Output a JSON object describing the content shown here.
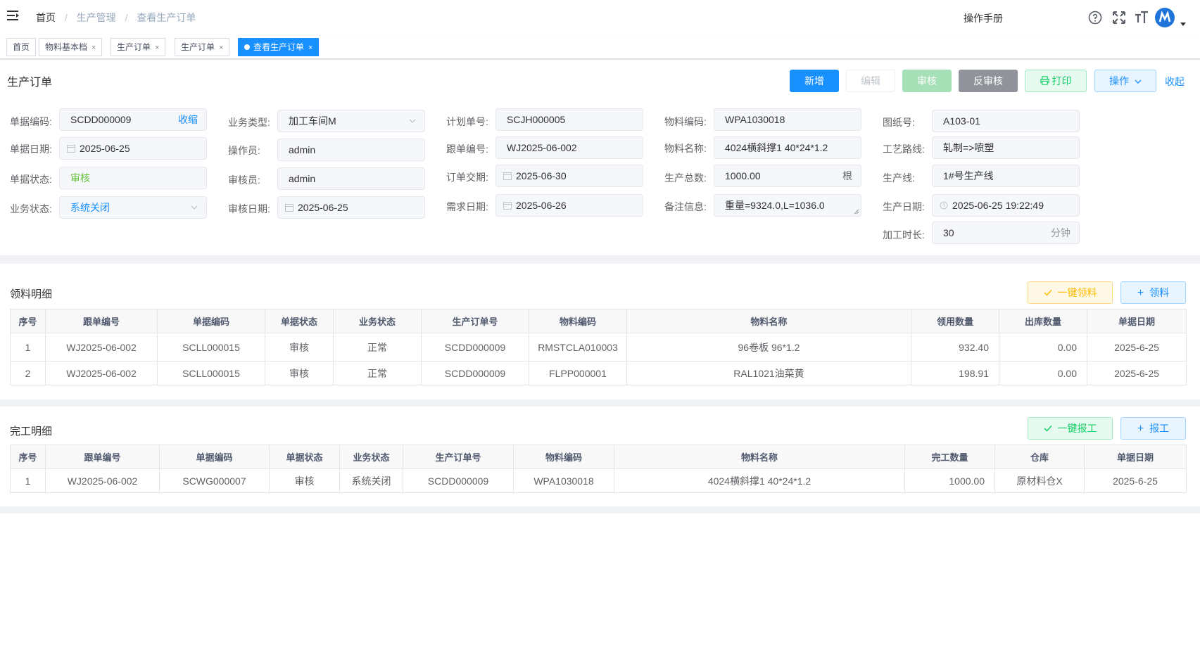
{
  "navbar": {
    "breadcrumb": [
      "首页",
      "生产管理",
      "查看生产订单"
    ],
    "manual_label": "操作手册"
  },
  "tags": [
    {
      "label": "首页",
      "active": false,
      "closable": false
    },
    {
      "label": "物料基本档",
      "active": false,
      "closable": true
    },
    {
      "label": "生产订单",
      "active": false,
      "closable": true
    },
    {
      "label": "生产订单",
      "active": false,
      "closable": true
    },
    {
      "label": "查看生产订单",
      "active": true,
      "closable": true
    }
  ],
  "header": {
    "title": "生产订单",
    "buttons": {
      "add": "新增",
      "edit": "编辑",
      "audit": "审核",
      "unaudit": "反审核",
      "print": "打印",
      "operate": "操作",
      "collapse": "收起"
    }
  },
  "form": {
    "col1": {
      "doc_code_label": "单据编码:",
      "doc_code": "SCDD000009",
      "doc_code_action": "收缩",
      "doc_date_label": "单据日期:",
      "doc_date": "2025-06-25",
      "doc_status_label": "单据状态:",
      "doc_status": "审核",
      "biz_status_label": "业务状态:",
      "biz_status": "系统关闭"
    },
    "col2": {
      "biz_type_label": "业务类型:",
      "biz_type": "加工车间M",
      "operator_label": "操作员:",
      "operator": "admin",
      "auditor_label": "审核员:",
      "auditor": "admin",
      "audit_date_label": "审核日期:",
      "audit_date": "2025-06-25"
    },
    "col3": {
      "plan_no_label": "计划单号:",
      "plan_no": "SCJH000005",
      "track_no_label": "跟单编号:",
      "track_no": "WJ2025-06-002",
      "delivery_label": "订单交期:",
      "delivery": "2025-06-30",
      "demand_date_label": "需求日期:",
      "demand_date": "2025-06-26"
    },
    "col4": {
      "mat_code_label": "物料编码:",
      "mat_code": "WPA1030018",
      "mat_name_label": "物料名称:",
      "mat_name": "4024横斜撑1 40*24*1.2",
      "total_label": "生产总数:",
      "total": "1000.00",
      "total_unit": "根",
      "remark_label": "备注信息:",
      "remark": "重量=9324.0,L=1036.0"
    },
    "col5": {
      "drawing_label": "图纸号:",
      "drawing": "A103-01",
      "route_label": "工艺路线:",
      "route": "轧制=>喷塑",
      "line_label": "生产线:",
      "line": "1#号生产线",
      "prod_date_label": "生产日期:",
      "prod_date": "2025-06-25 19:22:49",
      "duration_label": "加工时长:",
      "duration": "30",
      "duration_unit": "分钟"
    }
  },
  "material_section": {
    "title": "领料明细",
    "btn_one_click": "一键领料",
    "btn_pick": "领料",
    "columns": [
      "序号",
      "跟单编号",
      "单据编码",
      "单据状态",
      "业务状态",
      "生产订单号",
      "物料编码",
      "物料名称",
      "领用数量",
      "出库数量",
      "单据日期"
    ],
    "rows": [
      {
        "seq": "1",
        "track": "WJ2025-06-002",
        "code": "SCLL000015",
        "doc_status": "审核",
        "biz_status": "正常",
        "order": "SCDD000009",
        "mat_code": "RMSTCLA010003",
        "mat_name": "96卷板 96*1.2",
        "qty": "932.40",
        "out_qty": "0.00",
        "date": "2025-6-25"
      },
      {
        "seq": "2",
        "track": "WJ2025-06-002",
        "code": "SCLL000015",
        "doc_status": "审核",
        "biz_status": "正常",
        "order": "SCDD000009",
        "mat_code": "FLPP000001",
        "mat_name": "RAL1021油菜黄",
        "qty": "198.91",
        "out_qty": "0.00",
        "date": "2025-6-25"
      }
    ]
  },
  "finish_section": {
    "title": "完工明细",
    "btn_one_click": "一键报工",
    "btn_report": "报工",
    "columns": [
      "序号",
      "跟单编号",
      "单据编码",
      "单据状态",
      "业务状态",
      "生产订单号",
      "物料编码",
      "物料名称",
      "完工数量",
      "仓库",
      "单据日期"
    ],
    "rows": [
      {
        "seq": "1",
        "track": "WJ2025-06-002",
        "code": "SCWG000007",
        "doc_status": "审核",
        "biz_status": "系统关闭",
        "order": "SCDD000009",
        "mat_code": "WPA1030018",
        "mat_name": "4024横斜撑1 40*24*1.2",
        "qty": "1000.00",
        "warehouse": "原材料仓X",
        "date": "2025-6-25"
      }
    ]
  },
  "colors": {
    "primary": "#1890ff",
    "success": "#67c23a",
    "info": "#909399",
    "warning": "#ffba00"
  }
}
